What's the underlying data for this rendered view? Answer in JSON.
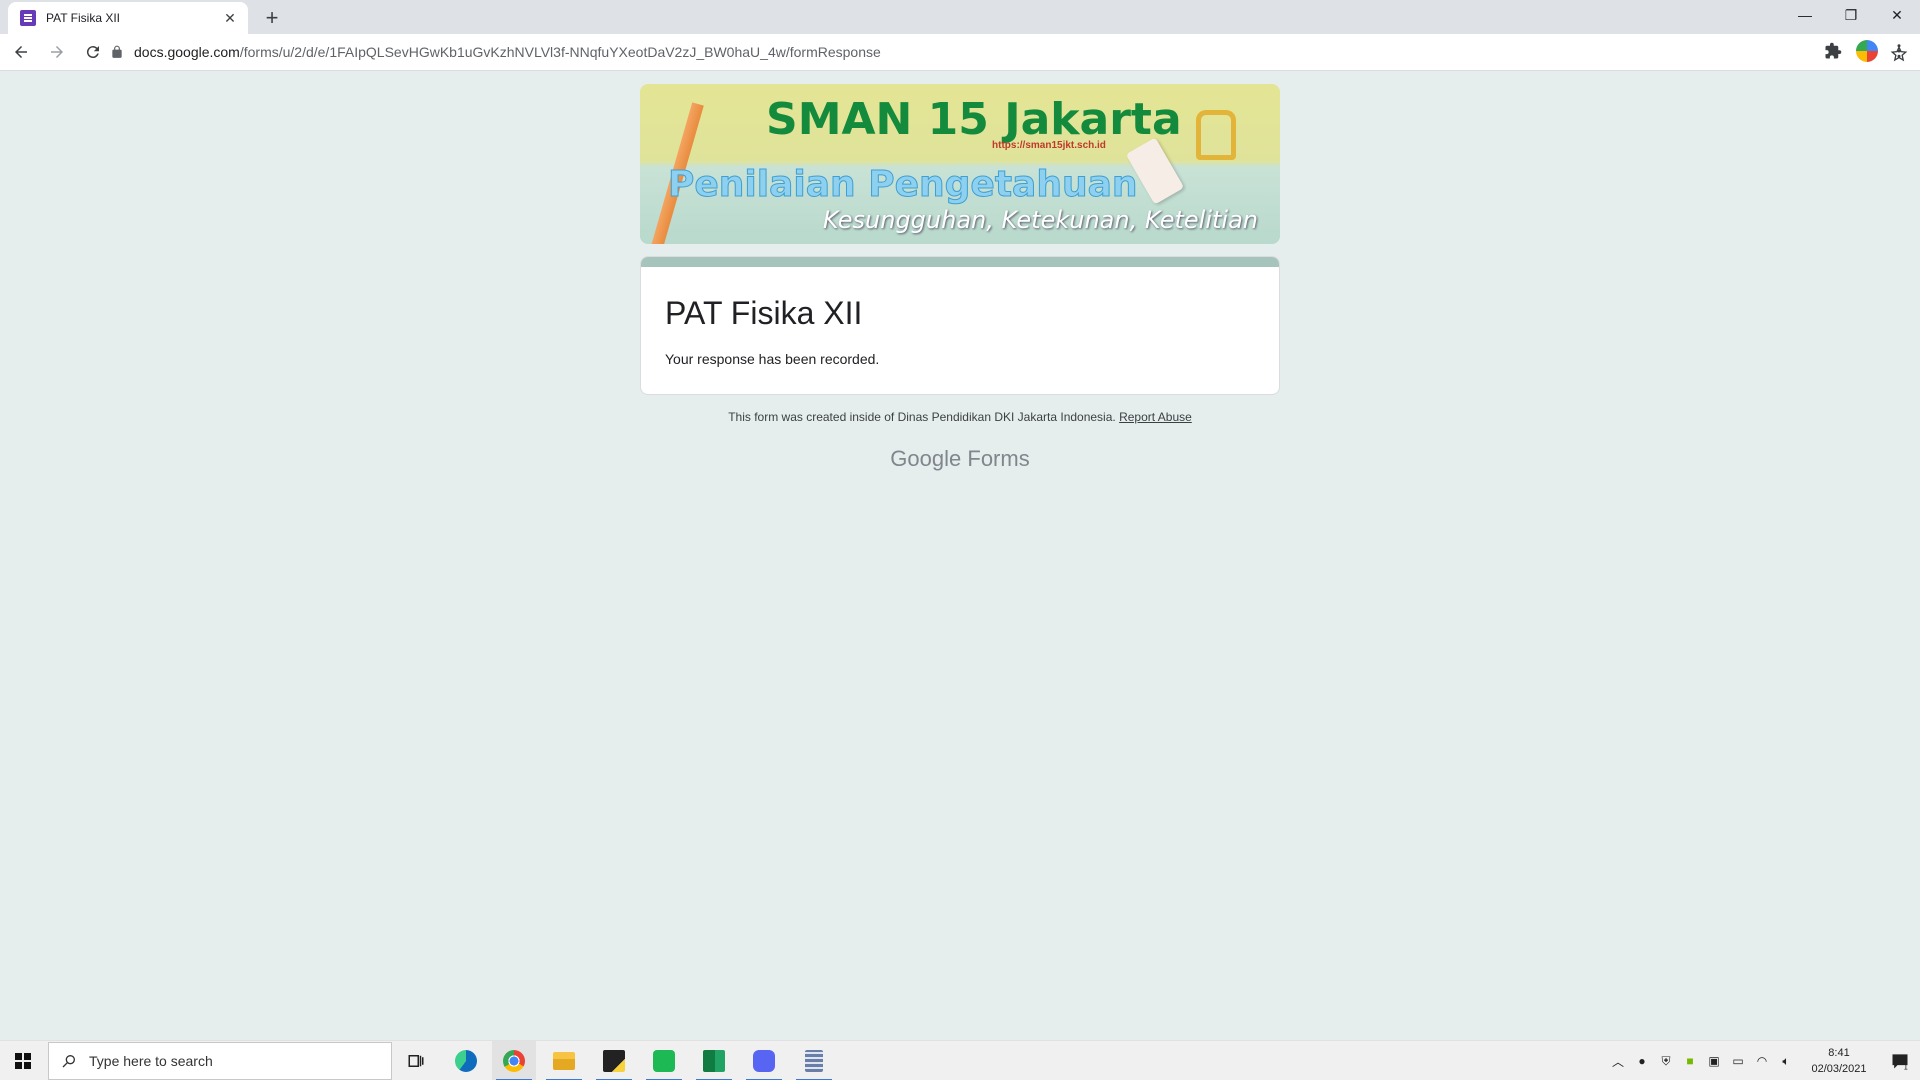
{
  "browser": {
    "tab_title": "PAT Fisika XII",
    "tab_close": "✕",
    "new_tab": "+",
    "url_domain": "docs.google.com",
    "url_path": "/forms/u/2/d/e/1FAIpQLSevHGwKb1uGvKzhNVLVl3f-NNqfuYXeotDaV2zJ_BW0haU_4w/formResponse",
    "window_controls": {
      "minimize": "—",
      "restore": "❐",
      "close": "✕"
    }
  },
  "banner": {
    "title": "SMAN 15 Jakarta",
    "url": "https://sman15jkt.sch.id",
    "subtitle": "Penilaian Pengetahuan",
    "motto": "Kesungguhan, Ketekunan, Ketelitian"
  },
  "form": {
    "title": "PAT Fisika XII",
    "confirmation": "Your response has been recorded.",
    "accent_color": "#a7c4bc"
  },
  "footer": {
    "text": "This form was created inside of Dinas Pendidikan DKI Jakarta Indonesia.",
    "report_link": "Report Abuse",
    "brand_google": "Google",
    "brand_forms": "Forms"
  },
  "taskbar": {
    "search_placeholder": "Type here to search",
    "apps": [
      "task-view",
      "edge",
      "chrome",
      "file-explorer",
      "sticky-notes",
      "spotify",
      "excel",
      "discord",
      "calculator"
    ],
    "clock_time": "8:41",
    "clock_date": "02/03/2021",
    "notification_count": "1"
  }
}
